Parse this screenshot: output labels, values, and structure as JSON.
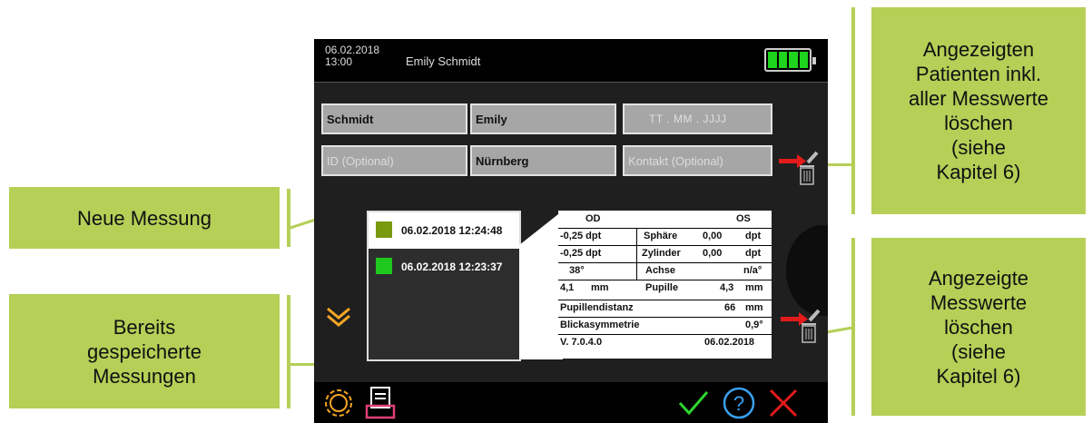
{
  "callouts": {
    "new_measurement": "Neue Messung",
    "saved_measurements_1": "Bereits",
    "saved_measurements_2": "gespeicherte",
    "saved_measurements_3": "Messungen",
    "delete_patient_1": "Angezeigten",
    "delete_patient_2": "Patienten inkl.",
    "delete_patient_3": "aller Messwerte",
    "delete_patient_4": "löschen",
    "delete_patient_5": "(siehe",
    "delete_patient_6": "Kapitel 6)",
    "delete_values_1": "Angezeigte",
    "delete_values_2": "Messwerte",
    "delete_values_3": "löschen",
    "delete_values_4": "(siehe",
    "delete_values_5": "Kapitel 6)",
    "color": "#b5cf57"
  },
  "header": {
    "date": "06.02.2018",
    "time": "13:00",
    "patient_name": "Emily Schmidt",
    "battery_color": "#1ed41e"
  },
  "form": {
    "last_name": "Schmidt",
    "first_name": "Emily",
    "birthdate_placeholder": "TT   .   MM   .   JJJJ",
    "id_placeholder": "ID (Optional)",
    "city": "Nürnberg",
    "contact_placeholder": "Kontakt (Optional)"
  },
  "measurements": [
    {
      "label": "06.02.2018 12:24:48",
      "color": "#7a9a0e"
    },
    {
      "label": "06.02.2018 12:23:37",
      "color": "#1ec81e"
    }
  ],
  "results": {
    "od": "OD",
    "os": "OS",
    "sphere_od": "-0,25 dpt",
    "sphere_label": "Sphäre",
    "sphere_os": "0,00",
    "sphere_unit": "dpt",
    "cyl_od": "-0,25 dpt",
    "cyl_label": "Zylinder",
    "cyl_os": "0,00",
    "cyl_unit": "dpt",
    "axis_od": "38°",
    "axis_label": "Achse",
    "axis_os": "n/a°",
    "pupil_od": "4,1",
    "pupil_od_unit": "mm",
    "pupil_label": "Pupille",
    "pupil_os": "4,3",
    "pupil_os_unit": "mm",
    "pd_label": "Pupillendistanz",
    "pd_value": "66",
    "pd_unit": "mm",
    "gaze_label": "Blickasymmetrie",
    "gaze_value": "0,9°",
    "version": "V. 7.0.4.0",
    "result_date": "06.02.2018"
  }
}
